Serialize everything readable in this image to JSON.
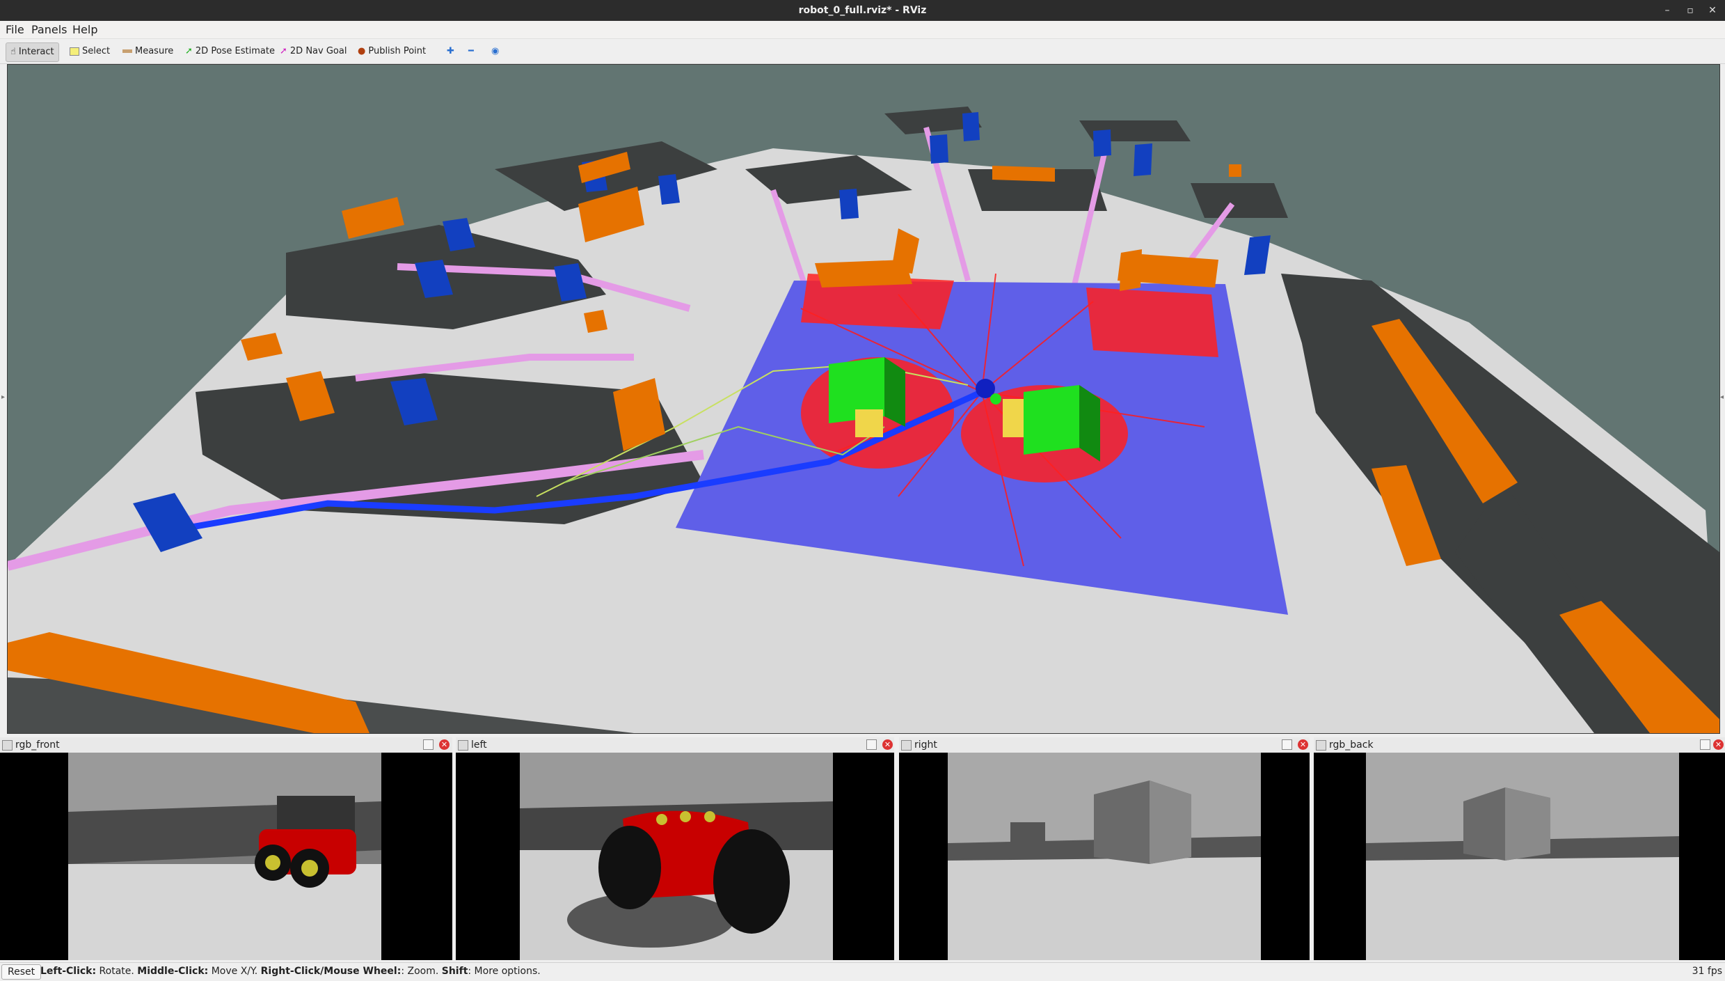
{
  "window": {
    "title": "robot_0_full.rviz* - RViz"
  },
  "menu": {
    "file": "File",
    "panels": "Panels",
    "help": "Help"
  },
  "toolbar": {
    "interact": "Interact",
    "select": "Select",
    "measure": "Measure",
    "pose_estimate": "2D Pose Estimate",
    "nav_goal": "2D Nav Goal",
    "publish_point": "Publish Point"
  },
  "panels": {
    "rgb_front": "rgb_front",
    "left": "left",
    "right": "right",
    "rgb_back": "rgb_back"
  },
  "status": {
    "reset": "Reset",
    "left_click_label": "Left-Click:",
    "left_click_text": " Rotate. ",
    "middle_click_label": "Middle-Click:",
    "middle_click_text": " Move X/Y. ",
    "right_click_label": "Right-Click/Mouse Wheel:",
    "right_click_text": ": Zoom. ",
    "shift_label": "Shift",
    "shift_text": ": More options.",
    "fps": "31 fps"
  },
  "colors": {
    "background": "#627572",
    "floor": "#d9d9d9",
    "shadow": "#3c3f3f",
    "inflation": "#e49be6",
    "costmap": "#5f5fe8",
    "laser": "#ff1a1a",
    "path": "#1a3cff",
    "goal": "#1fe01f",
    "box_orange": "#e67200",
    "box_blue": "#1240c0"
  }
}
